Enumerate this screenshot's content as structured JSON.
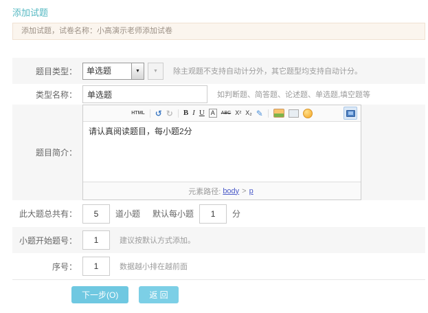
{
  "page": {
    "title": "添加试题"
  },
  "notice": {
    "text": "添加试题，试卷名称：小高演示老师添加试卷"
  },
  "form": {
    "question_type": {
      "label": "题目类型：",
      "value": "单选题",
      "hint": "除主观题不支持自动计分外，其它题型均支持自动计分。"
    },
    "type_name": {
      "label": "类型名称：",
      "value": "单选题",
      "hint": "如判断题、简答题、论述题、单选题,填空题等"
    },
    "intro": {
      "label": "题目简介：",
      "content": "请认真阅读题目，每小题2分"
    },
    "total": {
      "label": "此大题总共有：",
      "count": "5",
      "unit_count": "道小题",
      "default_label": "默认每小题",
      "score": "1",
      "unit_score": "分"
    },
    "start_no": {
      "label": "小题开始题号：",
      "value": "1",
      "hint": "建议按默认方式添加。"
    },
    "order": {
      "label": "序号：",
      "value": "1",
      "hint": "数据越小排在越前面"
    }
  },
  "editor": {
    "toolbar": {
      "html": "HTML",
      "undo": "↺",
      "redo": "↻",
      "bold": "B",
      "italic": "I",
      "underline": "U",
      "fontcolor": "A",
      "strike": "ABC",
      "sup": "X²",
      "sub": "X₂",
      "pencil": "✎"
    },
    "path": {
      "label": "元素路径:",
      "node1": "body",
      "sep": ">",
      "node2": "p"
    }
  },
  "icons": {
    "caret": "▼"
  },
  "buttons": {
    "next": "下一步(O)",
    "back": "返 回"
  },
  "colors": {
    "accent_teal": "#54b8c2",
    "notice_bg": "#fbf5ee",
    "notice_border": "#f0e1d2",
    "row_gray": "#f6f6f6",
    "button_blue": "#6fc8e1",
    "link_blue": "#4a5ac8"
  }
}
